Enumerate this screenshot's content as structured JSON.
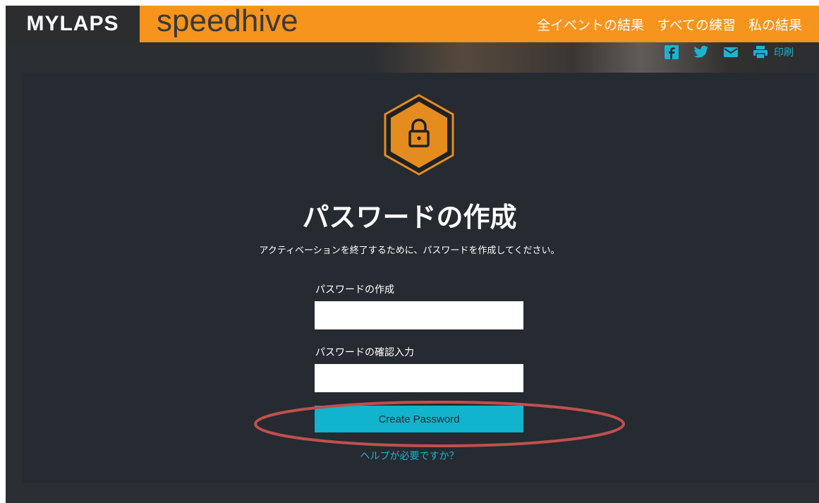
{
  "header": {
    "brand_mylaps": "MYLAPS",
    "brand_speedhive": "speedhive",
    "nav": [
      {
        "label": "全イベントの結果"
      },
      {
        "label": "すべての練習"
      },
      {
        "label": "私の結果"
      }
    ]
  },
  "social": {
    "icons": [
      "facebook-icon",
      "twitter-icon",
      "mail-icon",
      "print-icon"
    ],
    "print_label": "印刷"
  },
  "form": {
    "title": "パスワードの作成",
    "subtitle": "アクティベーションを終了するために、パスワードを作成してください。",
    "password_label": "パスワードの作成",
    "password_value": "",
    "confirm_label": "パスワードの確認入力",
    "confirm_value": "",
    "submit_label": "Create Password",
    "help_link": "ヘルプが必要ですか？"
  },
  "colors": {
    "brand_orange": "#f7941d",
    "accent_cyan": "#12b3cc",
    "card_bg": "#262a31",
    "annotation_red": "#c0504d"
  }
}
